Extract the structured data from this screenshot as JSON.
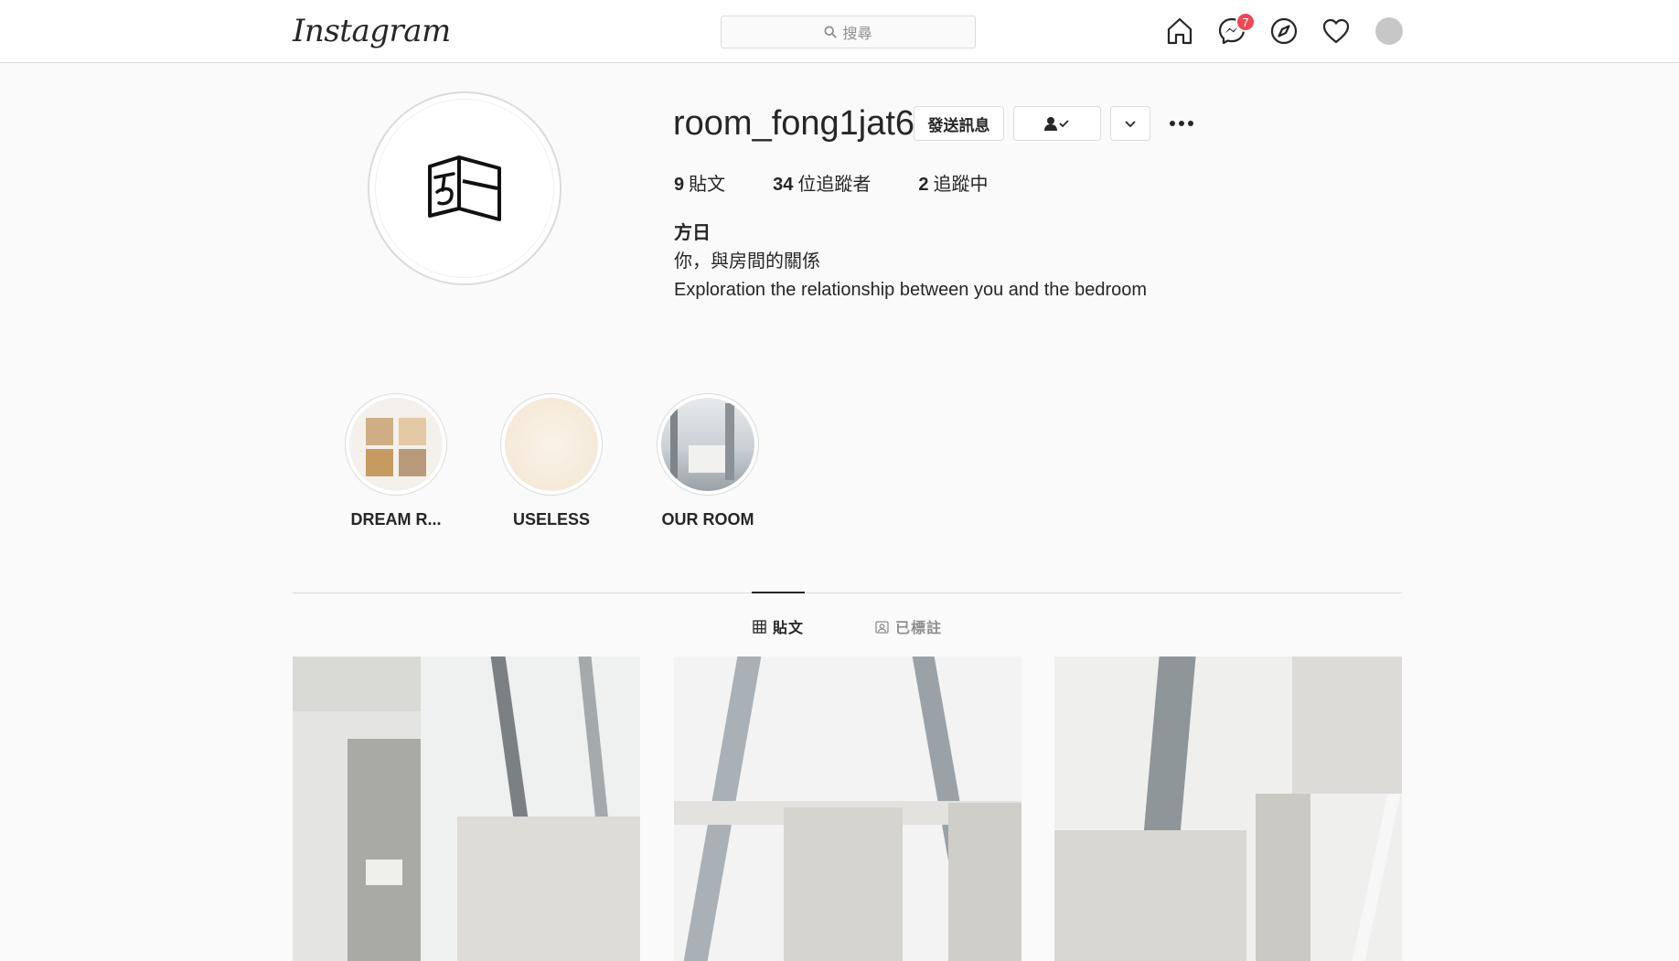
{
  "nav": {
    "logo_text": "Instagram",
    "search_placeholder": "搜尋",
    "messages_badge": "7",
    "icons": [
      "home-icon",
      "messenger-icon",
      "explore-icon",
      "activity-heart-icon",
      "profile-avatar"
    ]
  },
  "profile": {
    "username": "room_fong1jat6",
    "message_button": "發送訊息",
    "follow_status_icon": "person-check-icon",
    "dropdown_icon": "chevron-down-icon",
    "more_icon": "more-options-icon",
    "stats": {
      "posts_count": "9",
      "posts_label": "貼文",
      "followers_count": "34",
      "followers_label": "位追蹤者",
      "following_count": "2",
      "following_label": "追蹤中"
    },
    "full_name": "方日",
    "bio_line1": "你，與房間的關係",
    "bio_line2": "Exploration the relationship between you and the bedroom"
  },
  "highlights": [
    {
      "label": "DREAM R..."
    },
    {
      "label": "USELESS"
    },
    {
      "label": "OUR ROOM"
    }
  ],
  "tabs": {
    "posts": "貼文",
    "tagged": "已標註"
  },
  "colors": {
    "background": "#fafafa",
    "border": "#dbdbdb",
    "text": "#262626",
    "muted": "#8e8e8e",
    "badge": "#ed4956"
  }
}
